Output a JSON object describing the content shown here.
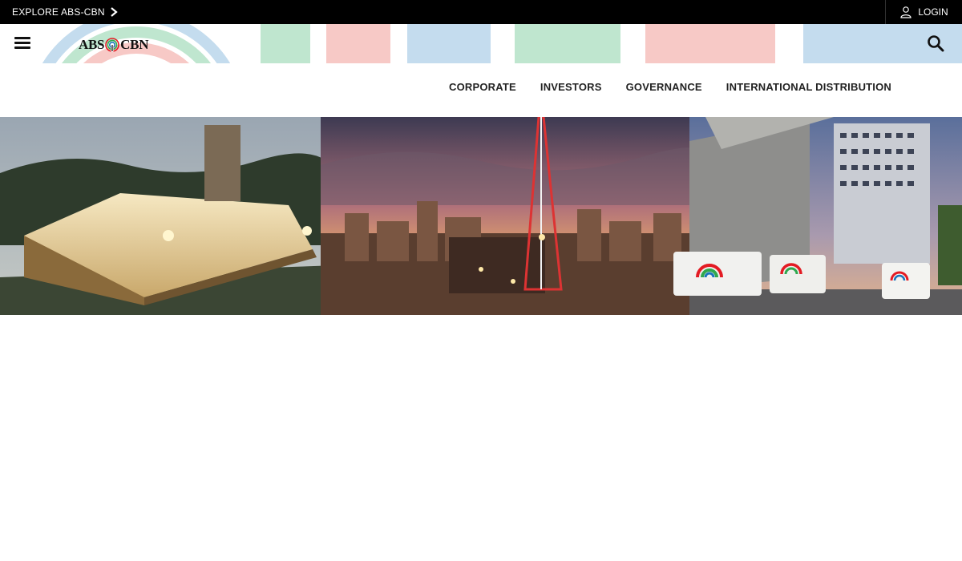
{
  "topbar": {
    "explore_label": "EXPLORE ABS-CBN",
    "explore_icon": "chevron-right-icon",
    "login_label": "LOGIN",
    "login_icon": "user-icon"
  },
  "header": {
    "menu_icon": "hamburger-icon",
    "logo_left": "ABS",
    "logo_right": "CBN",
    "search_icon": "search-icon"
  },
  "nav": {
    "items": [
      {
        "label": "CORPORATE"
      },
      {
        "label": "INVESTORS"
      },
      {
        "label": "GOVERNANCE"
      },
      {
        "label": "INTERNATIONAL DISTRIBUTION"
      }
    ]
  },
  "colors": {
    "topbar_bg": "#000000",
    "brand_red": "#e31b23",
    "brand_green": "#2fa84f",
    "brand_blue": "#1b75bc",
    "pattern_red": "#f7c9c6",
    "pattern_green": "#bfe6cf",
    "pattern_blue": "#c4dcee"
  }
}
